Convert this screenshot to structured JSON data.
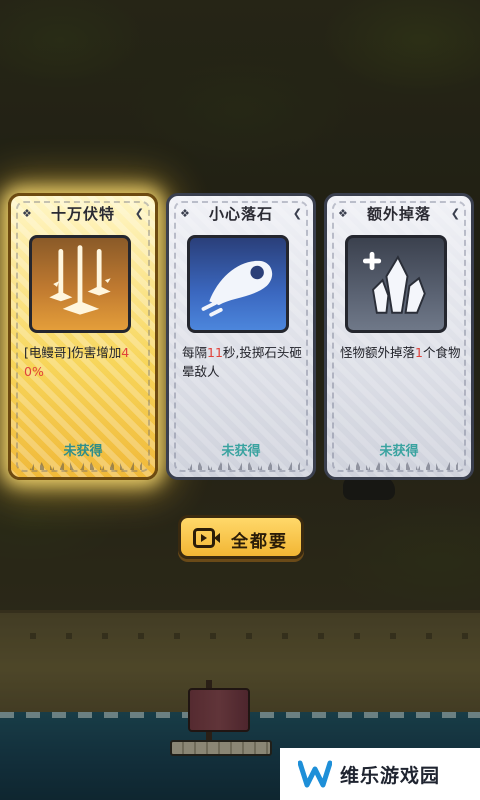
{
  "cards": [
    {
      "title": "十万伏特",
      "desc_before": "[电鳗哥]伤害增加",
      "desc_highlight": "40%",
      "desc_after": "",
      "status": "未获得",
      "icon": "lightning-strike-icon",
      "style": "gold"
    },
    {
      "title": "小心落石",
      "desc_before": "每隔",
      "desc_highlight": "11",
      "desc_after": "秒,投掷石头砸晕敌人",
      "status": "未获得",
      "icon": "falling-rock-icon",
      "style": "blue"
    },
    {
      "title": "额外掉落",
      "desc_before": "怪物额外掉落",
      "desc_highlight": "1",
      "desc_after": "个食物",
      "status": "未获得",
      "icon": "crystal-plus-icon",
      "style": "gray"
    }
  ],
  "button": {
    "label": "全都要",
    "icon": "video-ad-icon"
  },
  "watermark": {
    "text": "维乐游戏园",
    "logo": "W"
  },
  "colors": {
    "highlight": "#e0423b",
    "status": "#3aa3a0",
    "gold_glow": "#ffe278",
    "button": "#f2b634"
  }
}
